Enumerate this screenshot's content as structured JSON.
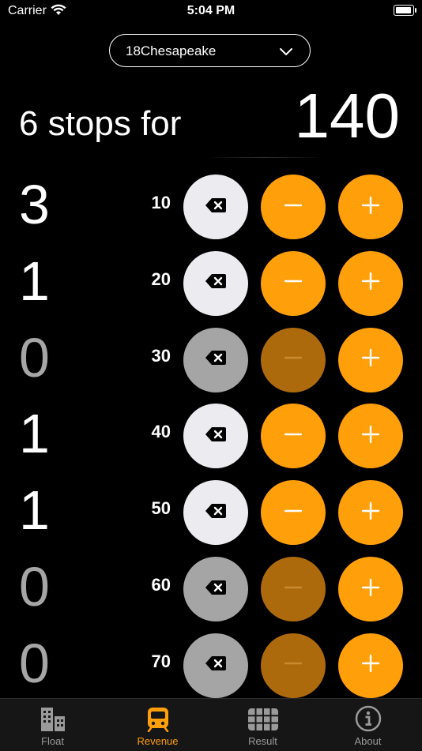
{
  "status": {
    "carrier": "Carrier",
    "time": "5:04 PM"
  },
  "picker": {
    "value": "18Chesapeake"
  },
  "summary": {
    "headline": "6 stops for",
    "total": "140"
  },
  "rows": [
    {
      "count": "3",
      "denom": "10"
    },
    {
      "count": "1",
      "denom": "20"
    },
    {
      "count": "0",
      "denom": "30"
    },
    {
      "count": "1",
      "denom": "40"
    },
    {
      "count": "1",
      "denom": "50"
    },
    {
      "count": "0",
      "denom": "60"
    },
    {
      "count": "0",
      "denom": "70"
    }
  ],
  "tabs": [
    {
      "label": "Float",
      "icon": "buildings-icon"
    },
    {
      "label": "Revenue",
      "icon": "train-icon"
    },
    {
      "label": "Result",
      "icon": "grid-icon"
    },
    {
      "label": "About",
      "icon": "info-icon"
    }
  ],
  "colors": {
    "accent": "#ff9f0a",
    "accent_dim": "#ad6a0d",
    "button_light": "#ebebf0",
    "button_dim": "#a5a5a5"
  }
}
